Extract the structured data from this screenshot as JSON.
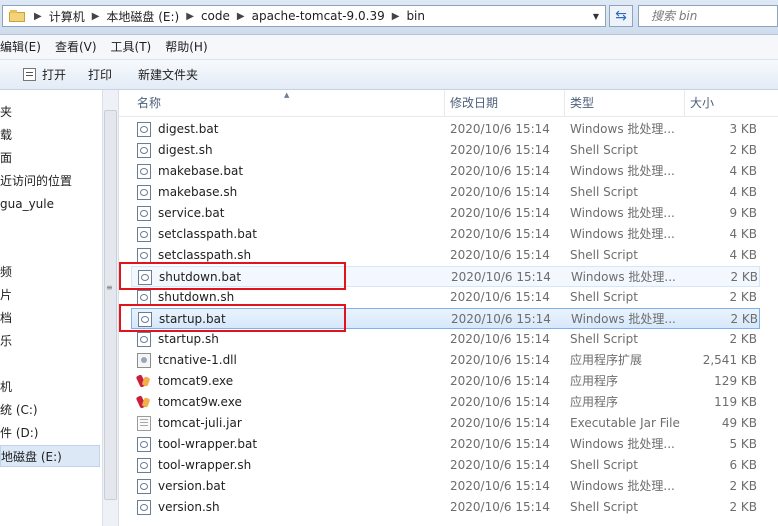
{
  "address": {
    "crumbs": [
      "计算机",
      "本地磁盘 (E:)",
      "code",
      "apache-tomcat-9.0.39",
      "bin"
    ],
    "search_placeholder": "搜索 bin"
  },
  "menu": [
    "编辑(E)",
    "查看(V)",
    "工具(T)",
    "帮助(H)"
  ],
  "commands": {
    "open": "打开",
    "print": "打印",
    "new_folder": "新建文件夹"
  },
  "nav": [
    "夹",
    "载",
    "面",
    "近访问的位置",
    "gua_yule",
    "频",
    "片",
    "档",
    "乐",
    "机",
    "统 (C:)",
    "件 (D:)",
    "地磁盘 (E:)"
  ],
  "columns": {
    "name": "名称",
    "date": "修改日期",
    "type": "类型",
    "size": "大小"
  },
  "files": [
    {
      "name": "digest.bat",
      "date": "2020/10/6 15:14",
      "type": "Windows 批处理...",
      "size": "3 KB",
      "icon": "batch-file-icon"
    },
    {
      "name": "digest.sh",
      "date": "2020/10/6 15:14",
      "type": "Shell Script",
      "size": "2 KB",
      "icon": "batch-file-icon"
    },
    {
      "name": "makebase.bat",
      "date": "2020/10/6 15:14",
      "type": "Windows 批处理...",
      "size": "4 KB",
      "icon": "batch-file-icon"
    },
    {
      "name": "makebase.sh",
      "date": "2020/10/6 15:14",
      "type": "Shell Script",
      "size": "4 KB",
      "icon": "batch-file-icon"
    },
    {
      "name": "service.bat",
      "date": "2020/10/6 15:14",
      "type": "Windows 批处理...",
      "size": "9 KB",
      "icon": "batch-file-icon"
    },
    {
      "name": "setclasspath.bat",
      "date": "2020/10/6 15:14",
      "type": "Windows 批处理...",
      "size": "4 KB",
      "icon": "batch-file-icon"
    },
    {
      "name": "setclasspath.sh",
      "date": "2020/10/6 15:14",
      "type": "Shell Script",
      "size": "4 KB",
      "icon": "batch-file-icon"
    },
    {
      "name": "shutdown.bat",
      "date": "2020/10/6 15:14",
      "type": "Windows 批处理...",
      "size": "2 KB",
      "icon": "batch-file-icon"
    },
    {
      "name": "shutdown.sh",
      "date": "2020/10/6 15:14",
      "type": "Shell Script",
      "size": "2 KB",
      "icon": "batch-file-icon"
    },
    {
      "name": "startup.bat",
      "date": "2020/10/6 15:14",
      "type": "Windows 批处理...",
      "size": "2 KB",
      "icon": "batch-file-icon"
    },
    {
      "name": "startup.sh",
      "date": "2020/10/6 15:14",
      "type": "Shell Script",
      "size": "2 KB",
      "icon": "batch-file-icon"
    },
    {
      "name": "tcnative-1.dll",
      "date": "2020/10/6 15:14",
      "type": "应用程序扩展",
      "size": "2,541 KB",
      "icon": "dll-file-icon"
    },
    {
      "name": "tomcat9.exe",
      "date": "2020/10/6 15:14",
      "type": "应用程序",
      "size": "129 KB",
      "icon": "tomcat-exe-icon"
    },
    {
      "name": "tomcat9w.exe",
      "date": "2020/10/6 15:14",
      "type": "应用程序",
      "size": "119 KB",
      "icon": "tomcat-exe-icon"
    },
    {
      "name": "tomcat-juli.jar",
      "date": "2020/10/6 15:14",
      "type": "Executable Jar File",
      "size": "49 KB",
      "icon": "jar-file-icon"
    },
    {
      "name": "tool-wrapper.bat",
      "date": "2020/10/6 15:14",
      "type": "Windows 批处理...",
      "size": "5 KB",
      "icon": "batch-file-icon"
    },
    {
      "name": "tool-wrapper.sh",
      "date": "2020/10/6 15:14",
      "type": "Shell Script",
      "size": "6 KB",
      "icon": "batch-file-icon"
    },
    {
      "name": "version.bat",
      "date": "2020/10/6 15:14",
      "type": "Windows 批处理...",
      "size": "2 KB",
      "icon": "batch-file-icon"
    },
    {
      "name": "version.sh",
      "date": "2020/10/6 15:14",
      "type": "Shell Script",
      "size": "2 KB",
      "icon": "batch-file-icon"
    }
  ],
  "selected_file": "startup.bat",
  "hovered_file": "shutdown.bat",
  "highlighted_files": [
    "shutdown.bat",
    "startup.bat"
  ],
  "colors": {
    "highlight": "#e1141d",
    "selection": "#7fb2ec"
  }
}
